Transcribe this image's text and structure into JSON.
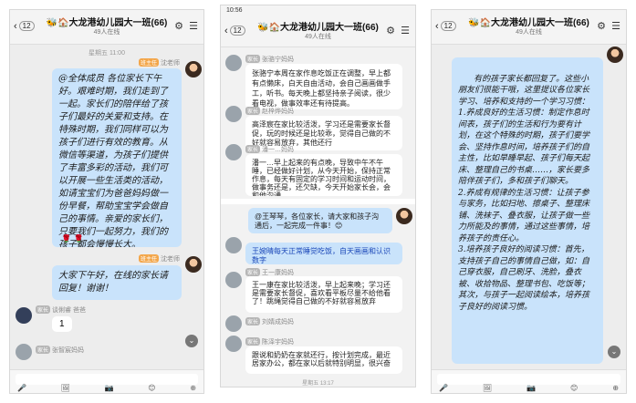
{
  "phone1": {
    "back_count": "12",
    "title": "🐝🏠大龙港幼儿园大一班(66)",
    "subtitle": "49人在线",
    "time": "星期五 11:00",
    "msg1_meta": "沈老师",
    "msg1_role": "班主任",
    "msg1_text": "@全体成员 各位家长下午好。艰难时期，我们走到了一起。家长们的陪伴给了孩子们最好的关爱和支持。在特殊时期，我们同样可以为孩子们进行有效的教育。从微信等渠道，为孩子们提供了丰富多彩的活动，我们可以开展一些生活类的活动，如请宝宝们为爸爸妈妈做一份早餐，帮助宝宝学会做自己的事情。亲爱的家长们，只要我们一起努力，我们的孩子都会慢慢长大。",
    "msg1_sign": "🌹 🌹",
    "msg2_meta": "沈老师",
    "msg2_text": "大家下午好，在线的家长请回复！谢谢！",
    "msg3_meta": "谈俐睿 爸爸",
    "msg3_text": "1",
    "msg4_meta": "张智宸妈妈",
    "input_icons": [
      "🎤",
      "🖼",
      "📷",
      "😊",
      "⊕"
    ]
  },
  "phone2": {
    "status_time": "10:56",
    "back_count": "12",
    "title": "🐝🏠大龙港幼儿园大一班(66)",
    "subtitle": "49人在线",
    "msgs": [
      {
        "meta": "张骆宁妈妈",
        "text": "张骆宁本周在家作息吃饭正在调整，早上都有点懒床，白天自由活动，会自己画画做手工，听书。每天晚上都坚持亲子阅读，很少看电视，做事效率还有待提高。"
      },
      {
        "meta": "赵梓烨妈妈",
        "text": "高泽宸在家比较活泼，学习还是需要家长督促，玩的时候还是比较乖，觉得自己做的不好就容易放弃，其他还行"
      },
      {
        "meta": "潘一…妈妈",
        "text": "潘一…早上起来的有点晚，导致中午不午睡，已经做好计划，从今天开始，保持正常作息，每天有固定的学习时间和运动时间，做事务还是，还欠缺，今天开始家长会，会和他沟通"
      }
    ],
    "quote_text": "@王琴琴，各位家长，请大家和孩子沟通后，一起完成一件事！😊",
    "quote2_text": "王婉晴每天正常睡觉吃饭，自天画画和认识数字",
    "msg_b1_meta": "王一康妈妈",
    "msg_b1_text": "王一康在家比较活泼，早上起来晚；学习还是需要家长督促，喜欢看平板尽量不给他看了！跳绳觉得自己做的不好就容易放弃",
    "msg_b2_meta": "刘婧成妈妈",
    "msg_b3_meta": "陈泽宇妈妈",
    "msg_b3_text": "跟说和奶奶在家就还行，按计划完成，最近居家办公，都在家以后就特别明显，很兴奋",
    "bottom_time": "星期五 13:17"
  },
  "phone3": {
    "back_count": "12",
    "title": "🐝🏠大龙港幼儿园大一班(66)",
    "subtitle": "49人在线",
    "time": "星期五",
    "main_text": "有的孩子家长都回复了。这些小朋友们很能干哦，这里提议各位家长学习、培养和支持的一个学习习惯：\n1.养成良好的生活习惯：制定作息时间表，孩子们的生活和行为要有计划，在这个特殊的时期，孩子们要学会、坚持作息时间，培养孩子们的自主性，比如早睡早起、孩子们每天起床、整理自己的书桌……，家长要多陪伴孩子们，多和孩子们聊天。\n2.养成有规律的生活习惯：让孩子参与家务，比如扫地、擦桌子、整理床铺、洗袜子、叠衣服，让孩子做一些力所能及的事情，通过这些事情，培养孩子的责任心。\n3.培养孩子良好的阅读习惯：首先，支持孩子自己的事情自己做，如：自己穿衣服，自己刷牙、洗脸，叠衣被、收拾物品、整理书包、吃饭等；其次，与孩子一起阅读绘本，培养孩子良好的阅读习惯。",
    "input_icons": [
      "🎤",
      "🖼",
      "📷",
      "😊",
      "⊕"
    ]
  }
}
